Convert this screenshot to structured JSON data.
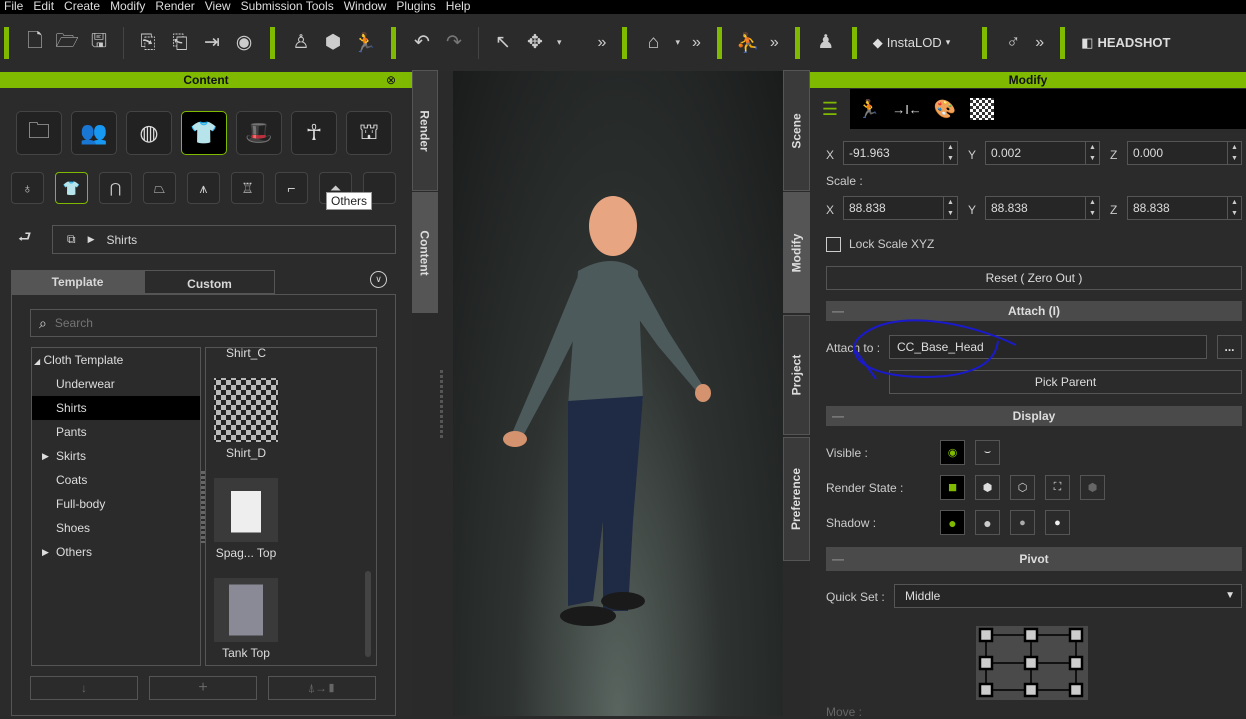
{
  "menu": [
    "File",
    "Edit",
    "Create",
    "Modify",
    "Render",
    "View",
    "Submission Tools",
    "Window",
    "Plugins",
    "Help"
  ],
  "toolbar": {
    "instalod": "InstaLOD",
    "headshot": "HEADSHOT"
  },
  "content": {
    "title": "Content",
    "tooltip": "Others",
    "breadcrumb": "Shirts",
    "tabs": [
      "Template",
      "Custom"
    ],
    "search_placeholder": "Search",
    "tree": {
      "root": "Cloth Template",
      "items": [
        "Underwear",
        "Shirts",
        "Pants",
        "Skirts",
        "Coats",
        "Full-body",
        "Shoes",
        "Others"
      ],
      "selected": "Shirts"
    },
    "thumbs": [
      "Shirt_C",
      "Shirt_D",
      "Spag... Top",
      "Tank Top"
    ]
  },
  "side_tabs_left": [
    "Render",
    "Content"
  ],
  "side_tabs_right": [
    "Scene",
    "Modify",
    "Project",
    "Preference"
  ],
  "modify": {
    "title": "Modify",
    "position": {
      "x": "-91.963",
      "y": "0.002",
      "z": "0.000"
    },
    "scale_label": "Scale :",
    "scale": {
      "x": "88.838",
      "y": "88.838",
      "z": "88.838"
    },
    "axis": [
      "X",
      "Y",
      "Z"
    ],
    "lock_scale": "Lock Scale XYZ",
    "lock_scale_checked": false,
    "reset": "Reset ( Zero Out )",
    "attach_section": "Attach  (I)",
    "attach_label": "Attach to :",
    "attach_value": "CC_Base_Head",
    "more": "...",
    "pick_parent": "Pick Parent",
    "display_section": "Display",
    "visible_label": "Visible :",
    "render_state_label": "Render State  :",
    "shadow_label": "Shadow :",
    "pivot_section": "Pivot",
    "quick_set_label": "Quick Set :",
    "quick_set_value": "Middle",
    "move_label": "Move :"
  },
  "colors": {
    "accent": "#7fba00",
    "annotation": "#1a1acc"
  }
}
